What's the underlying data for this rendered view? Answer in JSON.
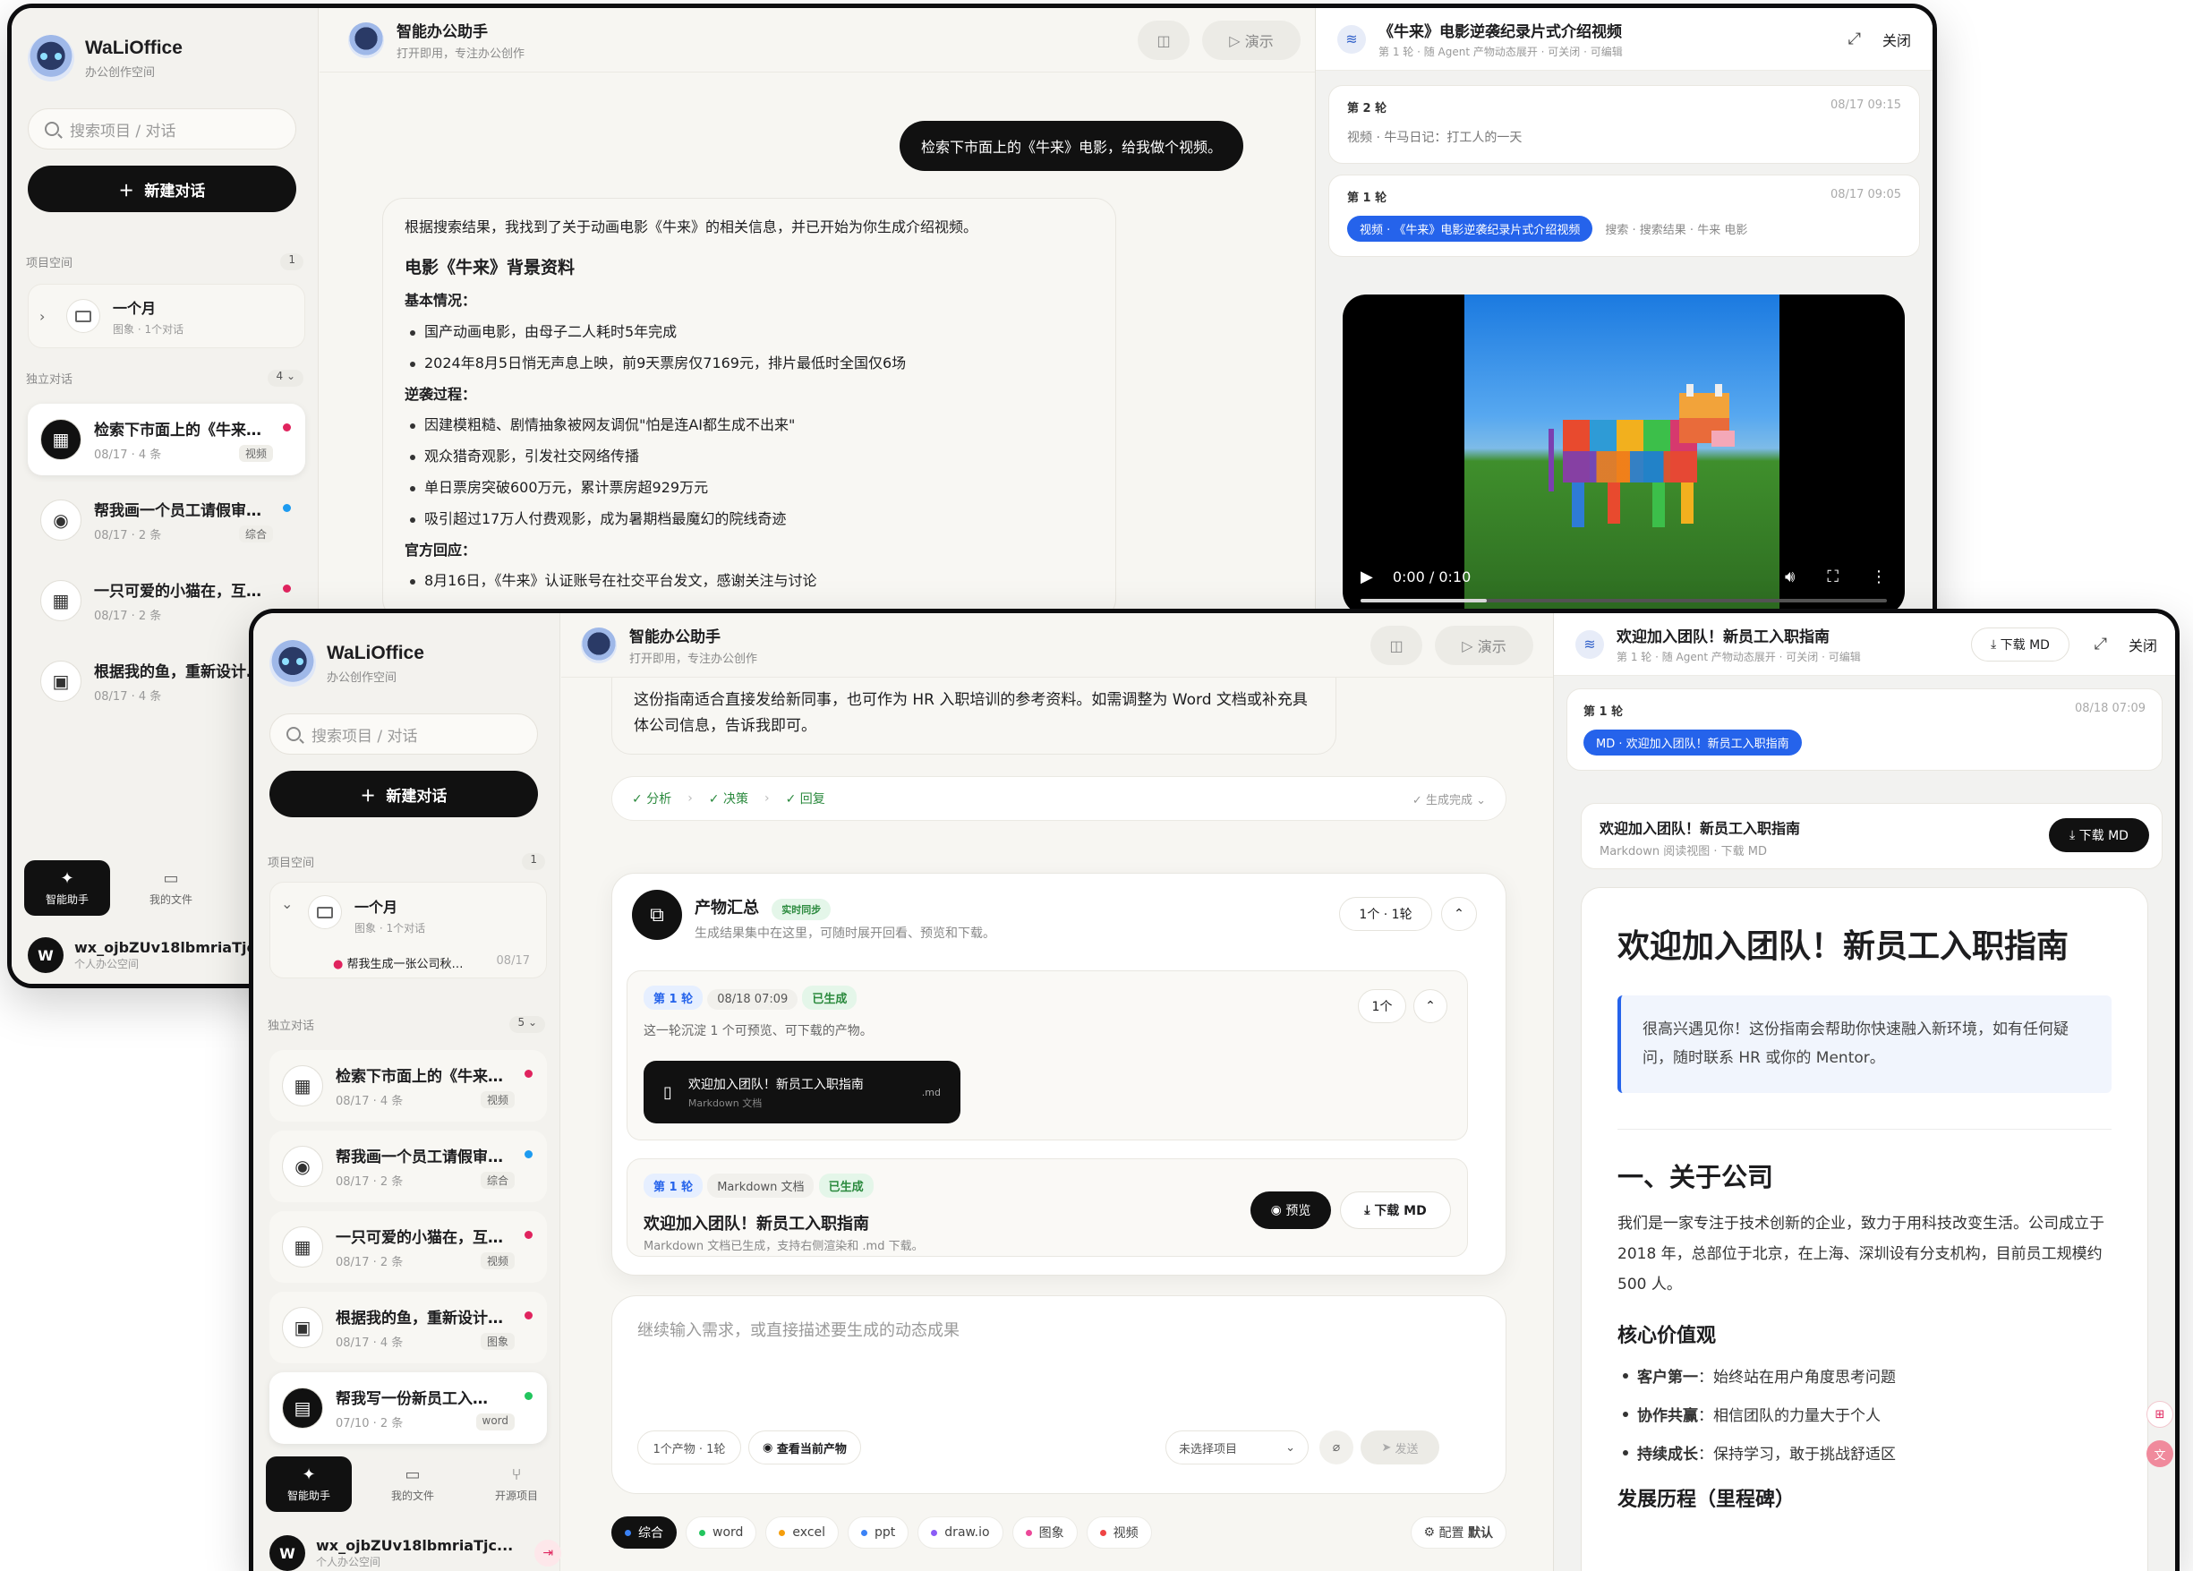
{
  "brand": {
    "name": "WaLiOffice",
    "subtitle": "办公创作空间"
  },
  "sidebar": {
    "search_placeholder": "搜索项目 / 对话",
    "new_chat": "新建对话",
    "projects_label": "项目空间",
    "projects_count": "1",
    "project": {
      "name": "一个月",
      "meta": "图象 · 1个对话",
      "sub_item": "帮我生成一张公司秋…",
      "sub_date": "08/17"
    },
    "standalone_label": "独立对话",
    "standalone_count_a": "4",
    "standalone_count_b": "5",
    "conversations": [
      {
        "title": "检索下市面上的《牛来》…",
        "date": "08/17",
        "count": "4 条",
        "tag": "视频",
        "dot": "#e0245e",
        "icon": "clapper-icon"
      },
      {
        "title": "帮我画一个员工请假审…",
        "date": "08/17",
        "count": "2 条",
        "tag": "综合",
        "dot": "#1d9bf0",
        "icon": "robot-icon"
      },
      {
        "title": "一只可爱的小猫在，互…",
        "date": "08/17",
        "count": "2 条",
        "tag": "视频",
        "dot": "#e0245e",
        "icon": "clapper-icon"
      },
      {
        "title": "根据我的鱼，重新设计…",
        "date": "08/17",
        "count": "4 条",
        "tag": "图象",
        "dot": "#e0245e",
        "icon": "image-icon"
      },
      {
        "title": "帮我写一份新员工入…",
        "date": "07/10",
        "count": "2 条",
        "tag": "word",
        "dot": "#22c55e",
        "icon": "document-icon"
      }
    ],
    "nav": [
      "智能助手",
      "我的文件",
      "开源项目"
    ],
    "user": {
      "avatar": "W",
      "name": "wx_ojbZUv18lbmriaTjc...",
      "space": "个人办公空间"
    }
  },
  "header": {
    "title": "智能办公助手",
    "subtitle": "打开即用，专注办公创作",
    "present": "演示"
  },
  "winA": {
    "user_message": "检索下市面上的《牛来》电影，给我做个视频。",
    "assistant_intro": "根据搜索结果，我找到了关于动画电影《牛来》的相关信息，并已开始为你生成介绍视频。",
    "heading": "电影《牛来》背景资料",
    "basic_label": "基本情况：",
    "basic": [
      "国产动画电影，由母子二人耗时5年完成",
      "2024年8月5日悄无声息上映，前9天票房仅7169元，排片最低时全国仅6场"
    ],
    "reverse_label": "逆袭过程：",
    "reverse": [
      "因建模粗糙、剧情抽象被网友调侃\"怕是连AI都生成不出来\"",
      "观众猎奇观影，引发社交网络传播",
      "单日票房突破600万元，累计票房超929万元",
      "吸引超过17万人付费观影，成为暑期档最魔幻的院线奇迹"
    ],
    "official_label": "官方回应：",
    "official": [
      "8月16日，《牛来》认证账号在社交平台发文，感谢关注与讨论"
    ],
    "panel": {
      "title": "《牛来》电影逆袭纪录片式介绍视频",
      "subtitle": "第 1 轮 · 随 Agent 产物动态展开 · 可关闭 · 可编辑",
      "close": "关闭",
      "rounds": [
        {
          "label": "第 2 轮",
          "time": "08/17 09:15",
          "item": "视频 · 牛马日记：打工人的一天"
        },
        {
          "label": "第 1 轮",
          "time": "08/17 09:05",
          "item_active": "视频 · 《牛来》电影逆袭纪录片式介绍视频",
          "item_other": "搜索 · 搜索结果 · 牛来 电影"
        }
      ],
      "video_time": "0:00 / 0:10"
    }
  },
  "winB": {
    "top_text": "这份指南适合直接发给新同事，也可作为 HR 入职培训的参考资料。如需调整为 Word 文档或补充具体公司信息，告诉我即可。",
    "steps": [
      "分析",
      "决策",
      "回复"
    ],
    "steps_done": "生成完成",
    "artifacts": {
      "title": "产物汇总",
      "sync": "实时同步",
      "desc": "生成结果集中在这里，可随时展开回看、预览和下载。",
      "count": "1个 · 1轮",
      "round": {
        "label": "第 1 轮",
        "time": "08/18 07:09",
        "status": "已生成",
        "desc": "这一轮沉淀 1 个可预览、可下载的产物。",
        "count": "1个"
      },
      "file": {
        "name": "欢迎加入团队！新员工入职指南",
        "type": "Markdown 文档",
        "ext": ".md"
      },
      "detail": {
        "round": "第 1 轮",
        "kind": "Markdown 文档",
        "status": "已生成",
        "title": "欢迎加入团队！新员工入职指南",
        "desc": "Markdown 文档已生成，支持右侧渲染和 .md 下载。",
        "preview": "预览",
        "download": "下载 MD"
      }
    },
    "input": {
      "placeholder": "继续输入需求，或直接描述要生成的动态成果",
      "meta": "1个产物 · 1轮",
      "view_current": "查看当前产物",
      "project_select": "未选择项目",
      "send": "发送",
      "config": "配置",
      "config_value": "默认"
    },
    "filters": [
      {
        "label": "综合",
        "color": "#3b82f6"
      },
      {
        "label": "word",
        "color": "#22c55e"
      },
      {
        "label": "excel",
        "color": "#f59e0b"
      },
      {
        "label": "ppt",
        "color": "#3b82f6"
      },
      {
        "label": "draw.io",
        "color": "#8b5cf6"
      },
      {
        "label": "图象",
        "color": "#ec4899"
      },
      {
        "label": "视频",
        "color": "#ef4444"
      }
    ],
    "panel": {
      "title": "欢迎加入团队！新员工入职指南",
      "subtitle": "第 1 轮 · 随 Agent 产物动态展开 · 可关闭 · 可编辑",
      "download": "下载 MD",
      "close": "关闭",
      "round": {
        "label": "第 1 轮",
        "time": "08/18 07:09",
        "item": "MD · 欢迎加入团队！新员工入职指南"
      },
      "doc_bar": {
        "title": "欢迎加入团队！新员工入职指南",
        "sub": "Markdown 阅读视图 · 下载 MD",
        "download": "下载 MD"
      },
      "doc": {
        "h1": "欢迎加入团队！新员工入职指南",
        "quote": "很高兴遇见你！这份指南会帮助你快速融入新环境，如有任何疑问，随时联系 HR 或你的 Mentor。",
        "h2": "一、关于公司",
        "p1": "我们是一家专注于技术创新的企业，致力于用科技改变生活。公司成立于 2018 年，总部位于北京，在上海、深圳设有分支机构，目前员工规模约 500 人。",
        "h3_values": "核心价值观",
        "values": [
          {
            "k": "客户第一",
            "v": "：始终站在用户角度思考问题"
          },
          {
            "k": "协作共赢",
            "v": "：相信团队的力量大于个人"
          },
          {
            "k": "持续成长",
            "v": "：保持学习，敢于挑战舒适区"
          }
        ],
        "h3_history": "发展历程（里程碑）"
      }
    }
  }
}
